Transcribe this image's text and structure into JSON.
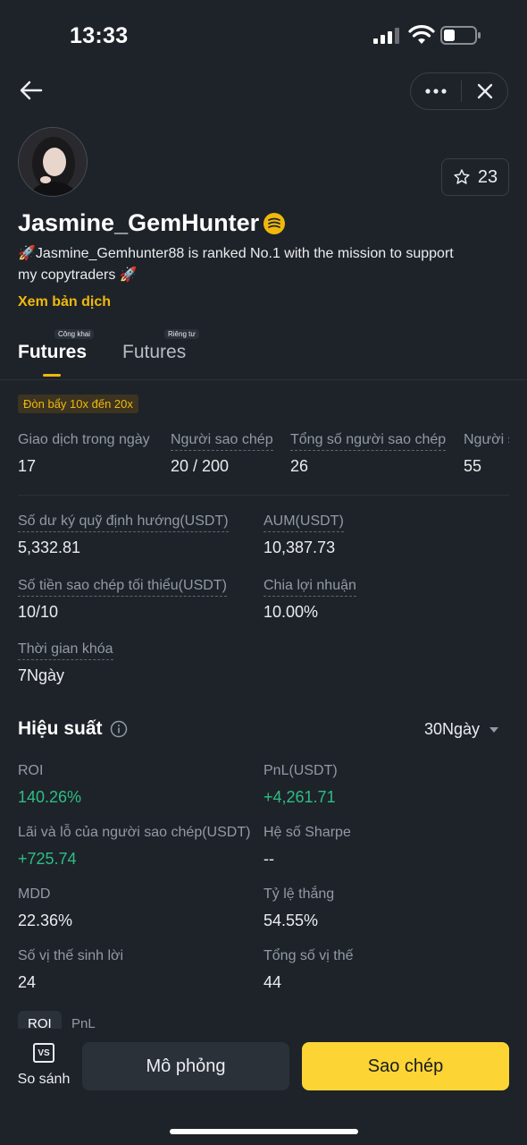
{
  "status_bar": {
    "time": "13:33"
  },
  "profile": {
    "username": "Jasmine_GemHunter",
    "bio": "🚀Jasmine_Gemhunter88 is ranked No.1 with the mission to support my copytraders 🚀",
    "translate_link": "Xem bản dịch",
    "favorites_count": "23"
  },
  "tabs": [
    {
      "label": "Futures",
      "tag": "Công khai",
      "active": true
    },
    {
      "label": "Futures",
      "tag": "Riêng tư",
      "active": false
    }
  ],
  "leverage_tag": "Đòn bẩy 10x đến 20x",
  "top_stats": [
    {
      "label": "Giao dịch trong ngày",
      "value": "17"
    },
    {
      "label": "Người sao chép",
      "value": "20 / 200"
    },
    {
      "label": "Tổng số người sao chép",
      "value": "26"
    },
    {
      "label": "Người s",
      "value": "55"
    }
  ],
  "details": {
    "deposit_label": "Số dư ký quỹ định hướng(USDT)",
    "deposit_value": "5,332.81",
    "aum_label": "AUM(USDT)",
    "aum_value": "10,387.73",
    "min_copy_label": "Số tiền sao chép tối thiểu(USDT)",
    "min_copy_value": "10/10",
    "profit_share_label": "Chia lợi nhuận",
    "profit_share_value": "10.00%",
    "lock_label": "Thời gian khóa",
    "lock_value": "7Ngày"
  },
  "performance": {
    "title": "Hiệu suất",
    "period": "30Ngày",
    "metrics": {
      "roi_label": "ROI",
      "roi_value": "140.26%",
      "pnl_label": "PnL(USDT)",
      "pnl_value": "+4,261.71",
      "copier_pnl_label": "Lãi và lỗ của người sao chép(USDT)",
      "copier_pnl_value": "+725.74",
      "sharpe_label": "Hệ số Sharpe",
      "sharpe_value": "--",
      "mdd_label": "MDD",
      "mdd_value": "22.36%",
      "win_rate_label": "Tỷ lệ thắng",
      "win_rate_value": "54.55%",
      "profit_pos_label": "Số vị thế sinh lời",
      "profit_pos_value": "24",
      "total_pos_label": "Tổng số vị thế",
      "total_pos_value": "44"
    },
    "chart_tabs": [
      "ROI",
      "PnL"
    ]
  },
  "bottom_bar": {
    "compare_icon_text": "VS",
    "compare_label": "So sánh",
    "simulate_label": "Mô phỏng",
    "copy_label": "Sao chép"
  },
  "colors": {
    "accent": "#f0b90b",
    "positive": "#2ebd85",
    "copy_button": "#fcd535",
    "background": "#1e2329"
  }
}
